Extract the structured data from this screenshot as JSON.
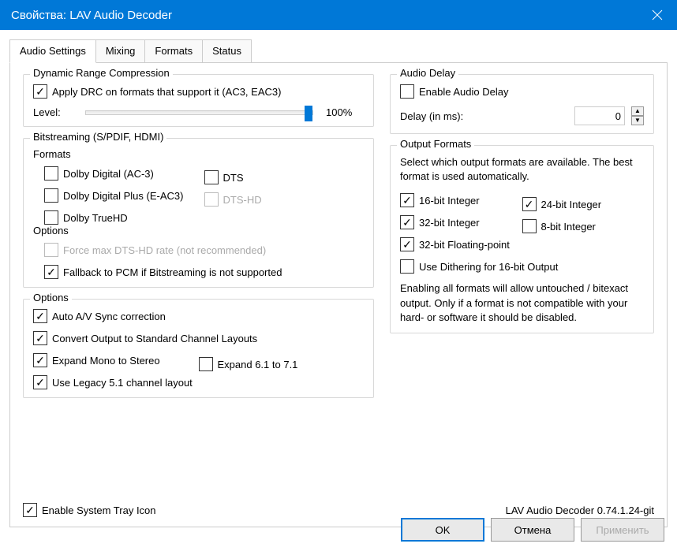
{
  "window": {
    "title": "Свойства: LAV Audio Decoder"
  },
  "tabs": {
    "audio": "Audio Settings",
    "mixing": "Mixing",
    "formats": "Formats",
    "status": "Status"
  },
  "drc": {
    "title": "Dynamic Range Compression",
    "apply": "Apply DRC on formats that support it (AC3, EAC3)",
    "level_label": "Level:",
    "level_value": "100%"
  },
  "bitstream": {
    "title": "Bitstreaming (S/PDIF, HDMI)",
    "formats_label": "Formats",
    "dolby_ac3": "Dolby Digital (AC-3)",
    "dts": "DTS",
    "dolby_eac3": "Dolby Digital Plus (E-AC3)",
    "dts_hd": "DTS-HD",
    "dolby_truehd": "Dolby TrueHD",
    "options_label": "Options",
    "force_max": "Force max DTS-HD rate (not recommended)",
    "fallback": "Fallback to PCM if Bitstreaming is not supported"
  },
  "options": {
    "title": "Options",
    "av_sync": "Auto A/V Sync correction",
    "convert": "Convert Output to Standard Channel Layouts",
    "expand_mono": "Expand Mono to Stereo",
    "expand_61": "Expand 6.1 to 7.1",
    "legacy_51": "Use Legacy 5.1 channel layout"
  },
  "tray": {
    "label": "Enable System Tray Icon"
  },
  "version": "LAV Audio Decoder 0.74.1.24-git",
  "delay": {
    "title": "Audio Delay",
    "enable": "Enable Audio Delay",
    "label": "Delay (in ms):",
    "value": "0"
  },
  "output": {
    "title": "Output Formats",
    "desc": "Select which output formats are available. The best format is used automatically.",
    "int16": "16-bit Integer",
    "int24": "24-bit Integer",
    "int32": "32-bit Integer",
    "int8": "8-bit Integer",
    "fp32": "32-bit Floating-point",
    "dither": "Use Dithering for 16-bit Output",
    "note": "Enabling all formats will allow untouched / bitexact output. Only if a format is not compatible with your hard- or software it should be disabled."
  },
  "buttons": {
    "ok": "OK",
    "cancel": "Отмена",
    "apply": "Применить"
  }
}
